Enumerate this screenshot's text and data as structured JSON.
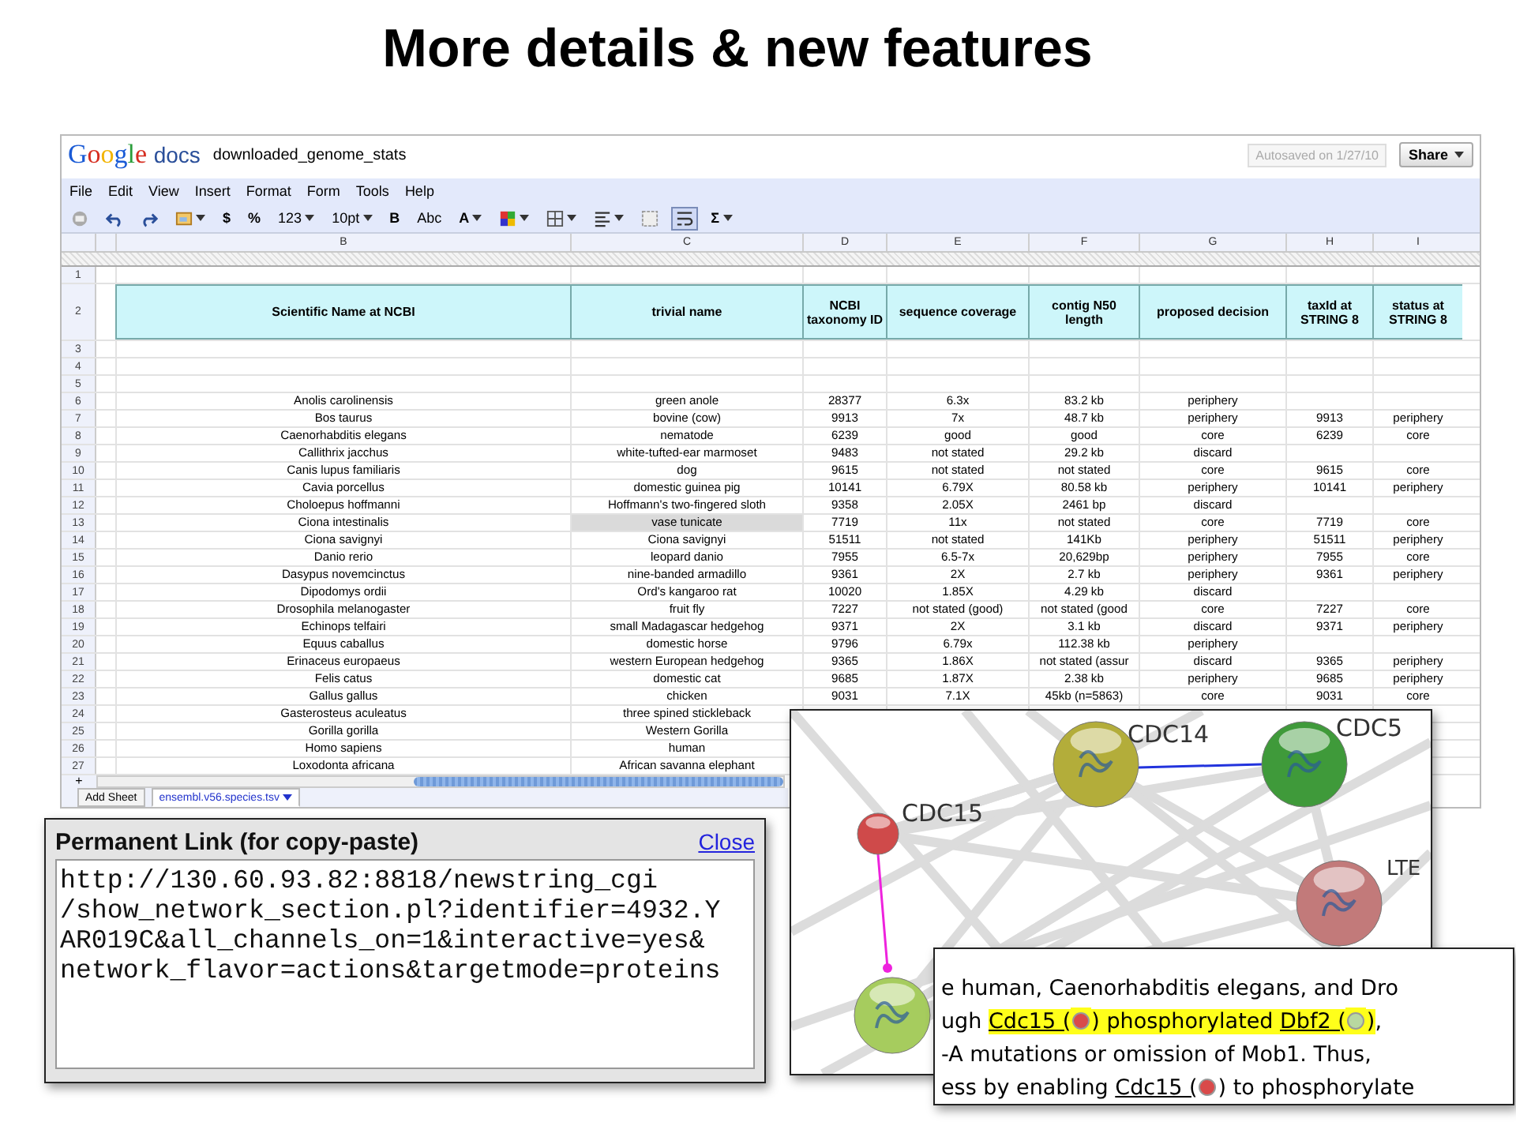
{
  "slide_title": "More details & new features",
  "doc": {
    "logo_main": "Google",
    "logo_sub": "docs",
    "title": "downloaded_genome_stats",
    "autosave": "Autosaved on 1/27/10",
    "share": "Share"
  },
  "menu": [
    "File",
    "Edit",
    "View",
    "Insert",
    "Format",
    "Form",
    "Tools",
    "Help"
  ],
  "toolbar": [
    {
      "kind": "icon",
      "dropdown": false,
      "selected": false
    },
    {
      "kind": "icon",
      "dropdown": false,
      "selected": false
    },
    {
      "kind": "icon",
      "dropdown": false,
      "selected": false
    },
    {
      "kind": "icon",
      "dropdown": true,
      "selected": false
    },
    {
      "kind": "text",
      "label": "$",
      "dropdown": false,
      "selected": false
    },
    {
      "kind": "text",
      "label": "%",
      "dropdown": false,
      "selected": false
    },
    {
      "kind": "text",
      "label": "123",
      "dropdown": true,
      "selected": false
    },
    {
      "kind": "text",
      "label": "10pt",
      "dropdown": true,
      "selected": false
    },
    {
      "kind": "text",
      "label": "B",
      "dropdown": false,
      "selected": false
    },
    {
      "kind": "text",
      "label": "Abc",
      "dropdown": false,
      "selected": false
    },
    {
      "kind": "text",
      "label": "A",
      "dropdown": true,
      "selected": false
    },
    {
      "kind": "icon",
      "dropdown": true,
      "selected": false
    },
    {
      "kind": "icon",
      "dropdown": true,
      "selected": false
    },
    {
      "kind": "icon",
      "dropdown": true,
      "selected": false
    },
    {
      "kind": "icon",
      "dropdown": false,
      "selected": false
    },
    {
      "kind": "icon",
      "dropdown": false,
      "selected": true
    },
    {
      "kind": "text",
      "label": "Σ",
      "dropdown": true,
      "selected": false
    }
  ],
  "sheet": {
    "columns": [
      "B",
      "C",
      "D",
      "E",
      "F",
      "G",
      "H",
      "I"
    ],
    "rows": [
      {
        "n": "1",
        "kind": "blank"
      },
      {
        "n": "2",
        "kind": "header",
        "cells": [
          "Scientific Name at NCBI",
          "trivial name",
          "NCBI taxonomy ID",
          "sequence coverage",
          "contig N50 length",
          "proposed decision",
          "taxId at STRING 8",
          "status at STRING 8"
        ]
      },
      {
        "n": "3",
        "kind": "blank"
      },
      {
        "n": "4",
        "kind": "blank"
      },
      {
        "n": "5",
        "kind": "blank"
      },
      {
        "n": "6",
        "kind": "data",
        "cells": [
          "Anolis carolinensis",
          "green anole",
          "28377",
          "6.3x",
          "83.2 kb",
          "periphery"
        ]
      },
      {
        "n": "7",
        "kind": "data",
        "cells": [
          "Bos taurus",
          "bovine (cow)",
          "9913",
          "7x",
          "48.7 kb",
          "periphery",
          "9913",
          "periphery"
        ]
      },
      {
        "n": "8",
        "kind": "data",
        "cells": [
          "Caenorhabditis elegans",
          "nematode",
          "6239",
          "good",
          "good",
          "core",
          "6239",
          "core"
        ]
      },
      {
        "n": "9",
        "kind": "data",
        "cells": [
          "Callithrix jacchus",
          "white-tufted-ear marmoset",
          "9483",
          "not stated",
          "29.2 kb",
          "discard"
        ]
      },
      {
        "n": "10",
        "kind": "data",
        "cells": [
          "Canis lupus familiaris",
          "dog",
          "9615",
          "not stated",
          "not stated",
          "core",
          "9615",
          "core"
        ]
      },
      {
        "n": "11",
        "kind": "data",
        "cells": [
          "Cavia porcellus",
          "domestic guinea pig",
          "10141",
          "6.79X",
          "80.58 kb",
          "periphery",
          "10141",
          "periphery"
        ]
      },
      {
        "n": "12",
        "kind": "data",
        "cells": [
          "Choloepus hoffmanni",
          "Hoffmann's two-fingered sloth",
          "9358",
          "2.05X",
          "2461 bp",
          "discard"
        ]
      },
      {
        "n": "13",
        "kind": "data",
        "cells": [
          "Ciona intestinalis",
          {
            "text": "vase tunicate",
            "selected": true
          },
          "7719",
          "11x",
          "not stated",
          "core",
          "7719",
          "core"
        ]
      },
      {
        "n": "14",
        "kind": "data",
        "cells": [
          "Ciona savignyi",
          "Ciona savignyi",
          "51511",
          "not stated",
          "141Kb",
          "periphery",
          "51511",
          "periphery"
        ]
      },
      {
        "n": "15",
        "kind": "data",
        "cells": [
          "Danio rerio",
          "leopard danio",
          "7955",
          "6.5-7x",
          "20,629bp",
          "periphery",
          "7955",
          "core"
        ]
      },
      {
        "n": "16",
        "kind": "data",
        "cells": [
          "Dasypus novemcinctus",
          "nine-banded armadillo",
          "9361",
          "2X",
          "2.7 kb",
          "periphery",
          "9361",
          "periphery"
        ]
      },
      {
        "n": "17",
        "kind": "data",
        "cells": [
          "Dipodomys ordii",
          "Ord's kangaroo rat",
          "10020",
          "1.85X",
          "4.29 kb",
          "discard"
        ]
      },
      {
        "n": "18",
        "kind": "data",
        "cells": [
          "Drosophila melanogaster",
          "fruit fly",
          "7227",
          "not stated (good)",
          "not stated (good",
          "core",
          "7227",
          "core"
        ]
      },
      {
        "n": "19",
        "kind": "data",
        "cells": [
          "Echinops telfairi",
          "small Madagascar hedgehog",
          "9371",
          "2X",
          "3.1 kb",
          "discard",
          "9371",
          "periphery"
        ]
      },
      {
        "n": "20",
        "kind": "data",
        "cells": [
          "Equus caballus",
          "domestic horse",
          "9796",
          "6.79x",
          "112.38 kb",
          "periphery"
        ]
      },
      {
        "n": "21",
        "kind": "data",
        "cells": [
          "Erinaceus europaeus",
          "western European hedgehog",
          "9365",
          "1.86X",
          "not stated (assur",
          "discard",
          "9365",
          "periphery"
        ]
      },
      {
        "n": "22",
        "kind": "data",
        "cells": [
          "Felis catus",
          "domestic cat",
          "9685",
          "1.87X",
          "2.38 kb",
          "periphery",
          "9685",
          "periphery"
        ]
      },
      {
        "n": "23",
        "kind": "data",
        "cells": [
          "Gallus gallus",
          "chicken",
          "9031",
          "7.1X",
          "45kb (n=5863)",
          "core",
          "9031",
          "core"
        ]
      },
      {
        "n": "24",
        "kind": "data",
        "cells": [
          "Gasterosteus aculeatus",
          "three spined stickleback"
        ]
      },
      {
        "n": "25",
        "kind": "data",
        "cells": [
          "Gorilla gorilla",
          "Western Gorilla"
        ]
      },
      {
        "n": "26",
        "kind": "data",
        "cells": [
          "Homo sapiens",
          "human"
        ]
      },
      {
        "n": "27",
        "kind": "data",
        "cells": [
          "Loxodonta africana",
          "African savanna elephant"
        ]
      }
    ],
    "add_row": "+",
    "add_sheet": "Add Sheet",
    "tabs": [
      {
        "label": "ensembl.v56.species.tsv",
        "selected": true
      }
    ]
  },
  "network": {
    "nodes": [
      {
        "label": "CDC14",
        "color": "#b3ad3a"
      },
      {
        "label": "CDC5",
        "color": "#3f9a3a"
      },
      {
        "label": "CDC15",
        "color": "#cf4a4a"
      },
      {
        "label": "LTE",
        "color": "#c27a7a"
      },
      {
        "color": "#a6cc5e"
      }
    ]
  },
  "excerpt": {
    "lines": [
      [
        {
          "kind": "text",
          "text": "e human, Caenorhabditis elegans, and Dro",
          "highlight": false
        }
      ],
      [
        {
          "kind": "text",
          "text": "ugh ",
          "highlight": false
        },
        {
          "kind": "link",
          "text": "Cdc15 (",
          "highlight": true
        },
        {
          "kind": "dot",
          "color": "#d94a4a",
          "highlight": true
        },
        {
          "kind": "text",
          "text": ") phosphorylated ",
          "highlight": true
        },
        {
          "kind": "link",
          "text": "Dbf2 (",
          "highlight": true
        },
        {
          "kind": "dot",
          "color": "#b8d8a0",
          "highlight": true
        },
        {
          "kind": "text",
          "text": ")",
          "highlight": true
        },
        {
          "kind": "text",
          "text": ",",
          "highlight": false
        }
      ],
      [
        {
          "kind": "text",
          "text": "-A mutations or omission of Mob1. Thus,",
          "highlight": false
        }
      ],
      [
        {
          "kind": "text",
          "text": "ess by enabling ",
          "highlight": false
        },
        {
          "kind": "link",
          "text": "Cdc15 (",
          "highlight": false
        },
        {
          "kind": "dot",
          "color": "#d94a4a",
          "highlight": false
        },
        {
          "kind": "text",
          "text": ") to phosphorylate",
          "highlight": false
        }
      ]
    ]
  },
  "permalink": {
    "title": "Permanent Link (for copy-paste)",
    "close": "Close",
    "lines": [
      "http://130.60.93.82:8818/newstring_cgi",
      "/show_network_section.pl?identifier=4932.Y",
      "AR019C&all_channels_on=1&interactive=yes&",
      "network_flavor=actions&targetmode=proteins"
    ]
  }
}
